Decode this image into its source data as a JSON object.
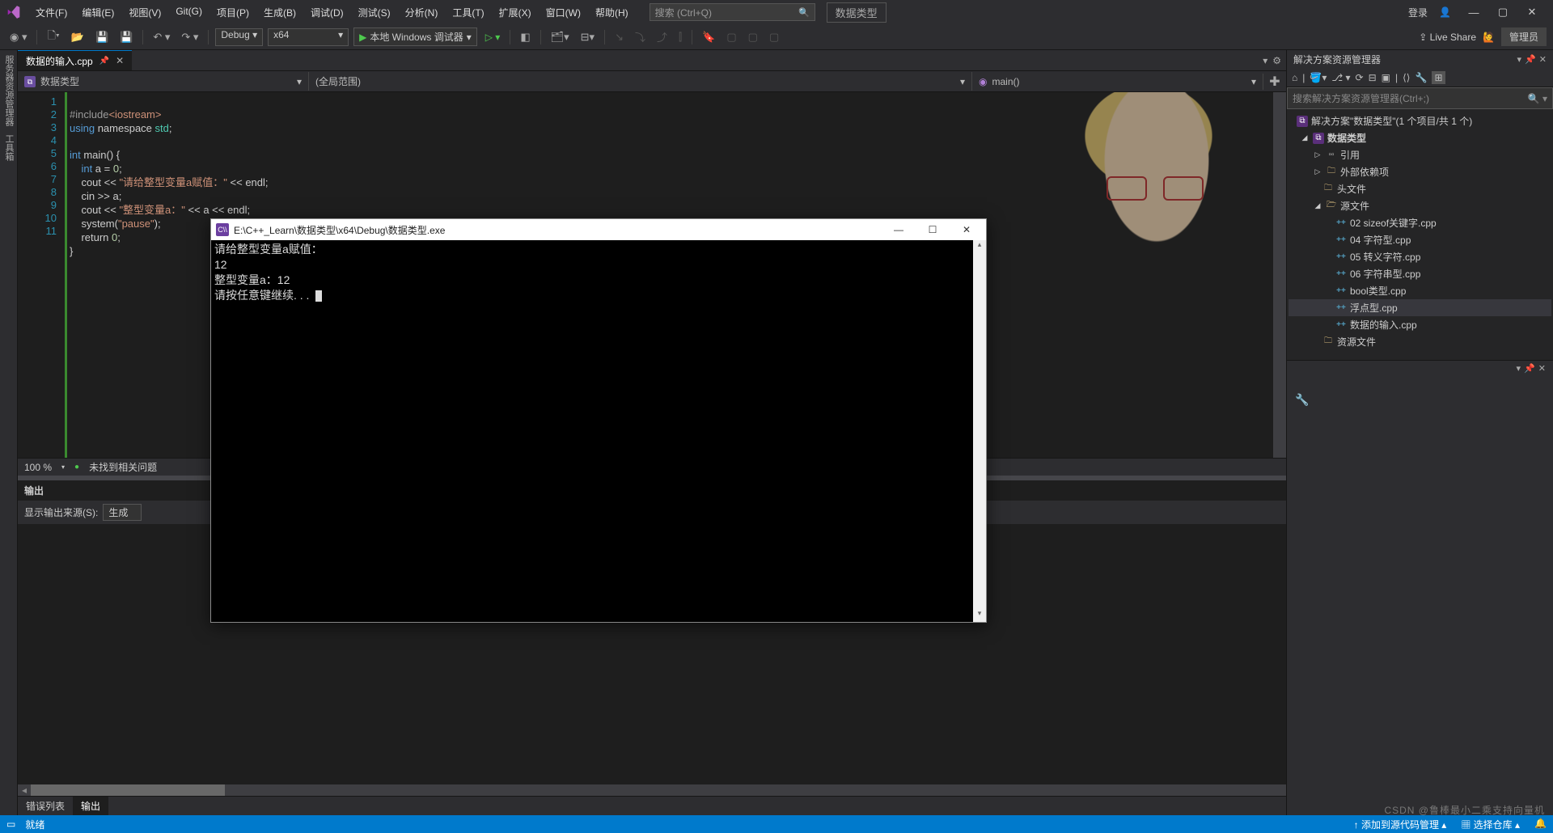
{
  "menu": {
    "items": [
      "文件(F)",
      "编辑(E)",
      "视图(V)",
      "Git(G)",
      "项目(P)",
      "生成(B)",
      "调试(D)",
      "测试(S)",
      "分析(N)",
      "工具(T)",
      "扩展(X)",
      "窗口(W)",
      "帮助(H)"
    ],
    "search_placeholder": "搜索 (Ctrl+Q)",
    "brand": "数据类型",
    "login": "登录",
    "admin": "管理员",
    "liveshare": "Live Share"
  },
  "toolbar": {
    "config": "Debug",
    "platform": "x64",
    "debuglabel": "本地 Windows 调试器"
  },
  "tab": {
    "name": "数据的输入.cpp"
  },
  "nav": {
    "scope": "数据类型",
    "global": "(全局范围)",
    "func": "main()"
  },
  "code": {
    "lines": [
      "1",
      "2",
      "3",
      "4",
      "5",
      "6",
      "7",
      "8",
      "9",
      "10",
      "11"
    ],
    "l1_a": "#include",
    "l1_b": "<iostream>",
    "l2_a": "using",
    "l2_b": " namespace ",
    "l2_c": "std",
    "l2_d": ";",
    "l4_a": "int",
    "l4_b": " main() {",
    "l5_a": "    int",
    "l5_b": " a = ",
    "l5_c": "0",
    "l5_d": ";",
    "l6_a": "    cout << ",
    "l6_b": "\"请给整型变量a赋值：\"",
    "l6_c": " << endl;",
    "l7": "    cin >> a;",
    "l8_a": "    cout << ",
    "l8_b": "\"整型变量a：\"",
    "l8_c": " << a << endl;",
    "l9_a": "    system(",
    "l9_b": "\"pause\"",
    "l9_c": ");",
    "l10_a": "    return ",
    "l10_b": "0",
    "l10_c": ";",
    "l11": "}"
  },
  "zoom": {
    "pct": "100 %",
    "issues": "未找到相关问题"
  },
  "output": {
    "title": "输出",
    "srclabel": "显示输出来源(S):",
    "src": "生成"
  },
  "bottomtabs": {
    "errors": "错误列表",
    "output": "输出"
  },
  "solExp": {
    "title": "解决方案资源管理器",
    "search_placeholder": "搜索解决方案资源管理器(Ctrl+;)",
    "solution": "解决方案\"数据类型\"(1 个项目/共 1 个)",
    "project": "数据类型",
    "refs": "引用",
    "ext": "外部依赖项",
    "headers": "头文件",
    "sources": "源文件",
    "files": [
      "02 sizeof关键字.cpp",
      "04 字符型.cpp",
      "05 转义字符.cpp",
      "06 字符串型.cpp",
      "bool类型.cpp",
      "浮点型.cpp",
      "数据的输入.cpp"
    ],
    "resources": "资源文件"
  },
  "leftstrip": {
    "a": "服务器资源管理器",
    "b": "工具箱"
  },
  "status": {
    "ready": "就绪",
    "git": "添加到源代码管理",
    "sel": "选择仓库"
  },
  "console": {
    "title": "E:\\C++_Learn\\数据类型\\x64\\Debug\\数据类型.exe",
    "l1": "请给整型变量a赋值：",
    "l2": "12",
    "l3": "整型变量a：12",
    "l4": "请按任意键继续. . . "
  },
  "watermark": "CSDN @鲁棒最小二乘支持向量机"
}
